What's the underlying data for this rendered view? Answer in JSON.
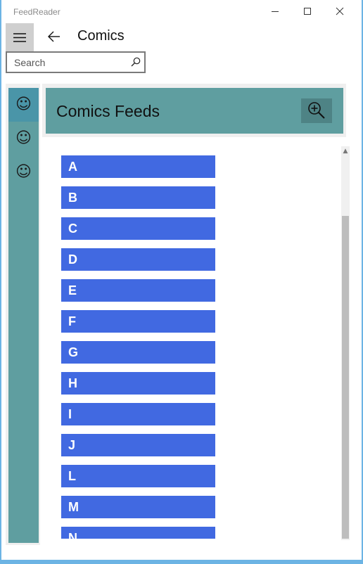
{
  "window": {
    "title": "FeedReader"
  },
  "header": {
    "title": "Comics"
  },
  "search": {
    "placeholder": "Search",
    "value": ""
  },
  "rail": {
    "items": [
      {
        "icon": "smiley-icon",
        "glyph": "☺",
        "selected": true
      },
      {
        "icon": "smiley-icon",
        "glyph": "☺",
        "selected": false
      },
      {
        "icon": "smiley-icon",
        "glyph": "☺",
        "selected": false
      }
    ]
  },
  "panel": {
    "title": "Comics Feeds",
    "zoom_icon": "zoom-in-icon"
  },
  "letters": [
    "A",
    "B",
    "C",
    "D",
    "E",
    "F",
    "G",
    "H",
    "I",
    "J",
    "L",
    "M",
    "N"
  ],
  "colors": {
    "accent": "#5f9ea0",
    "rail_selected": "#4a95a8",
    "letter_tile": "#4169e1",
    "frame": "#6cb4e4"
  }
}
